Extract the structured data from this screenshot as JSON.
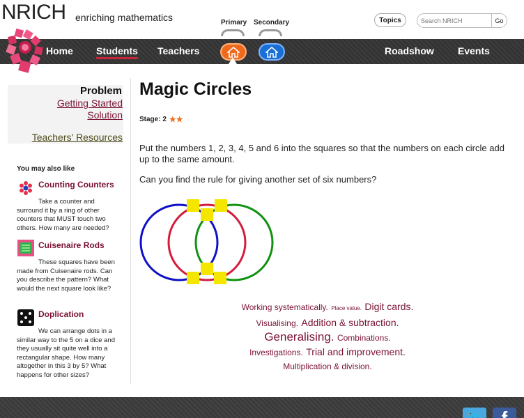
{
  "header": {
    "brand": "NRICH",
    "tagline": "enriching mathematics",
    "level_labels": [
      "Primary",
      "Secondary"
    ],
    "topics_button": "Topics",
    "search_placeholder": "Search NRICH",
    "search_go": "Go"
  },
  "nav": {
    "items": [
      "Home",
      "Students",
      "Teachers",
      "Roadshow",
      "Events"
    ],
    "active": "Students"
  },
  "sidebar": {
    "problem": "Problem",
    "links": [
      "Getting Started",
      "Solution"
    ],
    "teachers_resources": "Teachers' Resources",
    "also_like": "You may also like",
    "related": [
      {
        "title": "Counting Counters",
        "description": "Take a counter and surround it by a ring of other counters that MUST touch two others. How many are needed?",
        "icon": "counters-icon"
      },
      {
        "title": "Cuisenaire Rods",
        "description": "These squares have been made from Cuisenaire rods. Can you describe the pattern? What would the next square look like?",
        "icon": "cuisenaire-icon"
      },
      {
        "title": "Doplication",
        "description": "We can arrange dots in a similar way to the 5 on a dice and they usually sit quite well into a rectangular shape. How many altogether in this 3 by 5? What happens for other sizes?",
        "icon": "dots-icon"
      }
    ]
  },
  "main": {
    "title": "Magic Circles",
    "stage_label": "Stage: 2",
    "stage_stars": "★★",
    "paragraph1": "Put the numbers 1, 2, 3, 4, 5 and 6 into the squares so that the numbers on each circle add up to the same amount.",
    "paragraph2": "Can you find the rule for giving another set of six numbers?",
    "diagram_colors": {
      "circle_left": "#1010c8",
      "circle_middle": "#d41c3c",
      "circle_right": "#119111",
      "squares": "#f5e600"
    },
    "tags": [
      [
        {
          "text": "Working systematically.",
          "size": "md"
        },
        {
          "text": "Place value.",
          "size": "sm"
        },
        {
          "text": "Digit cards.",
          "size": "lg"
        }
      ],
      [
        {
          "text": "Visualising.",
          "size": "md"
        },
        {
          "text": "Addition & subtraction.",
          "size": "lg"
        }
      ],
      [
        {
          "text": "Generalising.",
          "size": "xl"
        },
        {
          "text": "Combinations.",
          "size": "md"
        }
      ],
      [
        {
          "text": "Investigations.",
          "size": "md"
        },
        {
          "text": "Trial and improvement.",
          "size": "lg"
        }
      ],
      [
        {
          "text": "Multiplication & division.",
          "size": "md"
        }
      ]
    ]
  },
  "footer": {
    "social": [
      "twitter-icon",
      "facebook-icon"
    ],
    "twitter_glyph": "🐦",
    "facebook_glyph": "f"
  }
}
